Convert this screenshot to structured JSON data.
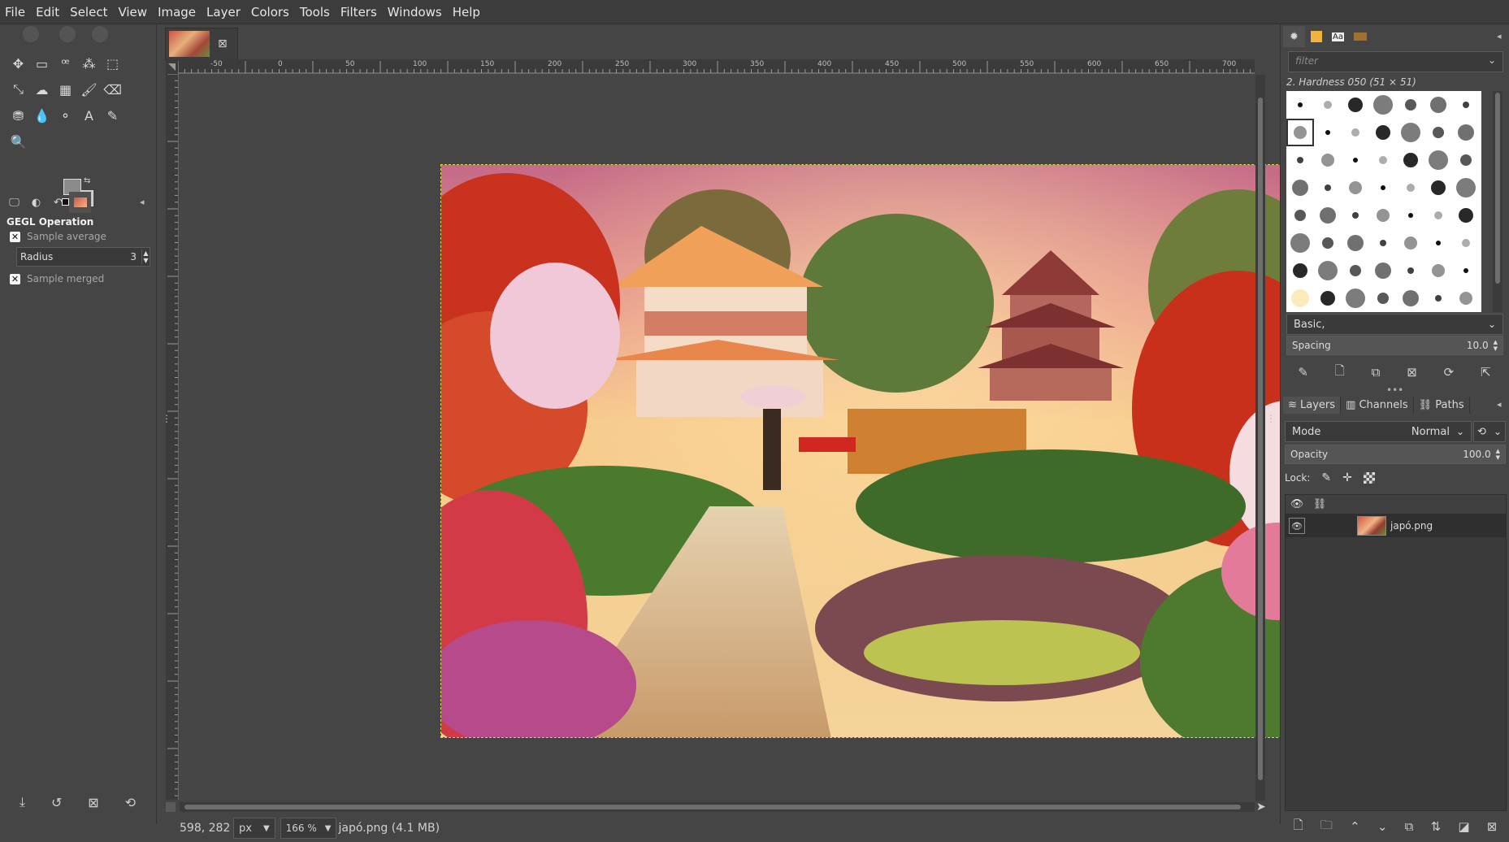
{
  "menu": [
    "File",
    "Edit",
    "Select",
    "View",
    "Image",
    "Layer",
    "Colors",
    "Tools",
    "Filters",
    "Windows",
    "Help"
  ],
  "tools": [
    {
      "icon": "move-icon"
    },
    {
      "icon": "rect-select-icon"
    },
    {
      "icon": "lasso-icon"
    },
    {
      "icon": "fuzzy-select-icon"
    },
    {
      "icon": "crop-icon"
    },
    {
      "icon": "unified-transform-icon"
    },
    {
      "icon": "warp-icon"
    },
    {
      "icon": "gradient-icon"
    },
    {
      "icon": "paintbrush-icon"
    },
    {
      "icon": "eraser-icon"
    },
    {
      "icon": "clone-icon"
    },
    {
      "icon": "smudge-icon"
    },
    {
      "icon": "paths-icon"
    },
    {
      "icon": "text-icon"
    },
    {
      "icon": "color-picker-icon"
    },
    {
      "icon": "zoom-icon"
    }
  ],
  "tool_glyphs": [
    "✥",
    "▭",
    "ꟹ",
    "⁂",
    "⬚",
    "⤡",
    "☁",
    "▦",
    "🖌",
    "⌫",
    "⛃",
    "💧",
    "⚬",
    "A",
    "✎",
    "🔍"
  ],
  "tool_options": {
    "title": "GEGL Operation",
    "sample_average": "Sample average",
    "radius_label": "Radius",
    "radius_value": "3",
    "sample_merged": "Sample merged"
  },
  "image_tab": {
    "close": "⊠"
  },
  "ruler_labels": [
    "-50",
    "0",
    "50",
    "100",
    "150",
    "200",
    "250",
    "300",
    "350",
    "400",
    "450",
    "500",
    "550",
    "600",
    "650",
    "700"
  ],
  "status": {
    "coords": "598, 282",
    "unit": "px",
    "zoom": "166 %",
    "file_info": "japó.png (4.1 MB)"
  },
  "brushes": {
    "filter_placeholder": "filter",
    "selected_name": "2. Hardness 050 (51 × 51)",
    "preset": "Basic,",
    "spacing_label": "Spacing",
    "spacing_value": "10.0"
  },
  "layers": {
    "tabs": [
      "Layers",
      "Channels",
      "Paths"
    ],
    "mode_label": "Mode",
    "mode_value": "Normal",
    "opacity_label": "Opacity",
    "opacity_value": "100.0",
    "lock_label": "Lock:",
    "layer_name": "japó.png"
  },
  "colors": {
    "photo_sky_top": "#d87a8a",
    "photo_sky_mid": "#f0b07a",
    "photo_foliage_red": "#c8321e",
    "photo_foliage_green": "#3f6b2a"
  }
}
